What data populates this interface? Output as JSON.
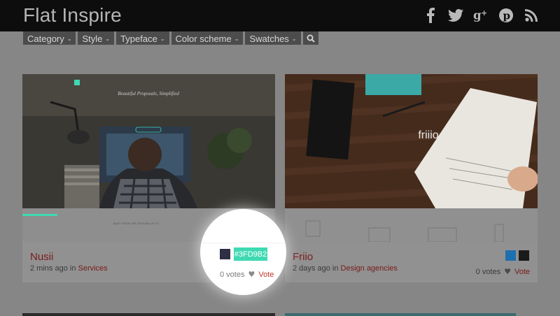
{
  "header": {
    "logo": "Flat Inspire"
  },
  "social": [
    "facebook-icon",
    "twitter-icon",
    "google-plus-icon",
    "pinterest-icon",
    "rss-icon"
  ],
  "filters": [
    "Category",
    "Style",
    "Typeface",
    "Color scheme",
    "Swatches"
  ],
  "cards": [
    {
      "title": "Nusii",
      "time": "2 mins ago",
      "in": "in",
      "category": "Services",
      "swatch_colors": [
        "#2e2f45"
      ],
      "swatch_hex": "#3FD9B2",
      "votes": "0 votes",
      "vote_label": "Vote",
      "thumb_headline": "Beautiful Proposals, Simplified",
      "thumb_sub": "BUILT FROM THE GROUND UP TO HELP YOU CREATE BEAUTIFUL PROPOSALS, FAST"
    },
    {
      "title": "Friio",
      "time": "2 days ago",
      "in": "in",
      "category": "Design agencies",
      "swatch_colors": [
        "#1e6fae",
        "#1a1a1a"
      ],
      "votes": "0 votes",
      "vote_label": "Vote",
      "thumb_brand": "friiio"
    }
  ],
  "colors": {
    "header_bg": "#0d0d0d",
    "accent_red": "#c0392b",
    "hex_badge": "#3fd9b2"
  }
}
